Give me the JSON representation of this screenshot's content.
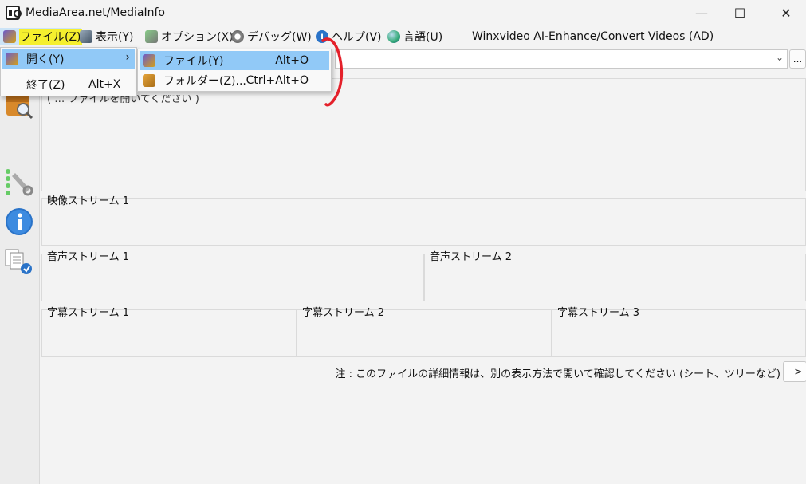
{
  "window": {
    "title": "MediaArea.net/MediaInfo",
    "controls": {
      "minimize": "—",
      "maximize": "☐",
      "close": "✕"
    }
  },
  "menubar": {
    "items": [
      {
        "label": "ファイル(Z)",
        "icon": "file-open-icon"
      },
      {
        "label": "表示(Y)",
        "icon": "view-icon"
      },
      {
        "label": "オプション(X)",
        "icon": "options-icon"
      },
      {
        "label": "デバッグ(W)",
        "icon": "debug-icon"
      },
      {
        "label": "ヘルプ(V)",
        "icon": "info-icon"
      },
      {
        "label": "言語(U)",
        "icon": "globe-icon"
      },
      {
        "label": "Winxvideo AI-Enhance/Convert Videos (AD)"
      }
    ]
  },
  "file_menu": {
    "open": {
      "label": "開く(Y)",
      "arrow": "›"
    },
    "exit": {
      "label": "終了(Z)",
      "shortcut": "Alt+X"
    }
  },
  "open_submenu": {
    "file": {
      "label": "ファイル(Y)",
      "shortcut": "Alt+O"
    },
    "folder": {
      "label": "フォルダー(Z)...",
      "shortcut": "Ctrl+Alt+O"
    }
  },
  "top": {
    "partial_hint": "( … ファイルを開いてください )",
    "browse_label": "...",
    "combo_arrow": "⌄"
  },
  "panels": {
    "video": [
      "映像ストリーム 1"
    ],
    "audio": [
      "音声ストリーム 1",
      "音声ストリーム 2"
    ],
    "subtitle": [
      "字幕ストリーム 1",
      "字幕ストリーム 2",
      "字幕ストリーム 3"
    ]
  },
  "footer": {
    "note": "注 : このファイルの詳細情報は、別の表示方法で開いて確認してください (シート、ツリーなど)",
    "next_label": "-->"
  },
  "colors": {
    "menu_highlight": "#cce4f7",
    "selected": "#91c9f7",
    "marker_yellow": "#f5ef2e",
    "annotation_red": "#e4202a"
  }
}
